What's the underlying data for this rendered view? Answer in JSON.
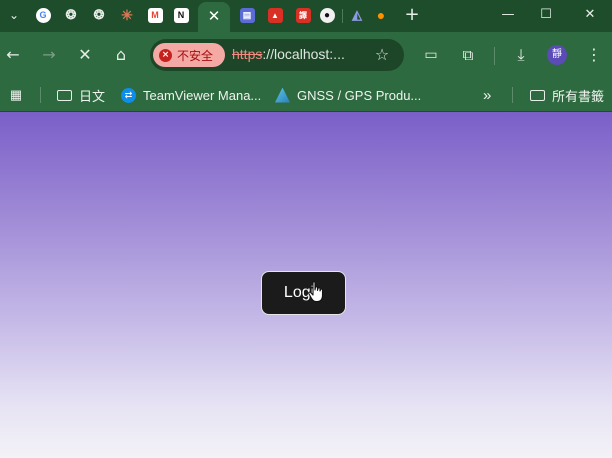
{
  "browser": {
    "tabs": [
      {
        "icon": "google-icon",
        "glyph": "G",
        "color": "#4285f4"
      },
      {
        "icon": "chatgpt-icon",
        "glyph": "◎",
        "color": "#2b2b2b"
      },
      {
        "icon": "chatgpt-icon",
        "glyph": "◎",
        "color": "#2b2b2b"
      },
      {
        "icon": "claude-icon",
        "glyph": "✳",
        "color": "#d97757"
      },
      {
        "icon": "gmail-icon",
        "glyph": "M",
        "color": "#ea4335"
      },
      {
        "icon": "notion-icon",
        "glyph": "N",
        "color": "#111111"
      },
      {
        "icon": "docs-icon",
        "glyph": "▤",
        "color": "#5b6bd8"
      },
      {
        "icon": "warning-icon",
        "glyph": "▲",
        "color": "#d93025"
      },
      {
        "icon": "translate-icon",
        "glyph": "譯",
        "color": "#d93025"
      },
      {
        "icon": "github-icon",
        "glyph": "●",
        "color": "#f0f0f0"
      },
      {
        "icon": "vercel-icon",
        "glyph": "◭",
        "color": "#7c8cd6"
      },
      {
        "icon": "firebase-icon",
        "glyph": "●",
        "color": "#ff9100"
      }
    ],
    "active_tab_close": "✕",
    "new_tab": "+",
    "window_controls": {
      "minimize": "—",
      "maximize": "☐",
      "close": "✕"
    }
  },
  "toolbar": {
    "security_label": "不安全",
    "url_scheme": "https",
    "url_rest": "://localhost:...",
    "avatar_text": "靜"
  },
  "bookmarks": {
    "items": [
      {
        "label": "日文",
        "icon": "folder-icon"
      },
      {
        "label": "TeamViewer Mana...",
        "icon": "teamviewer-icon"
      },
      {
        "label": "GNSS / GPS Produ...",
        "icon": "gnss-icon"
      }
    ],
    "overflow": "»",
    "all_bookmarks": "所有書籤"
  },
  "page": {
    "login_label": "Login"
  },
  "colors": {
    "gradient_top": "#7a5fc8",
    "gradient_bottom": "#f3f2f6",
    "button_bg": "#1b1b1b"
  }
}
